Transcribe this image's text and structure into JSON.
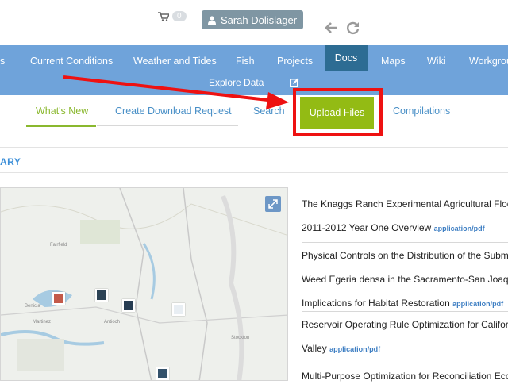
{
  "topbar": {
    "cart_count": "0",
    "user_name": "Sarah Dolislager"
  },
  "nav": {
    "items": [
      "s",
      "Current Conditions",
      "Weather and Tides",
      "Fish",
      "Projects",
      "Docs",
      "Maps",
      "Wiki",
      "Workgrou"
    ],
    "active": "Docs",
    "sub_label": "Explore Data"
  },
  "subtabs": {
    "items": [
      "What's New",
      "Create Download Request",
      "Search",
      "Upload Files",
      "Compilations"
    ],
    "active": "What's New",
    "highlighted": "Upload Files"
  },
  "section": {
    "title": "ARY"
  },
  "documents": [
    {
      "lines": [
        "The Knaggs Ranch Experimental Agricultural Floo",
        "2011-2012 Year One Overview"
      ],
      "type": "application/pdf"
    },
    {
      "lines": [
        "Physical Controls on the Distribution of the Subme",
        "Weed Egeria densa in the Sacramento-San Joaqui",
        "Implications for Habitat Restoration"
      ],
      "type": "application/pdf"
    },
    {
      "lines": [
        "Reservoir Operating Rule Optimization for Califor",
        "Valley"
      ],
      "type": "application/pdf"
    },
    {
      "lines": [
        "Multi-Purpose Optimization for Reconciliation Eco"
      ],
      "type": ""
    }
  ],
  "colors": {
    "navbar": "#6fa3da",
    "nav_active": "#2d6c93",
    "upload_btn": "#93bb14",
    "annotation_red": "#ee1111",
    "link_blue": "#4a90c7",
    "whatsnew_green": "#8ab82e"
  },
  "icons": [
    "cart-icon",
    "user-icon",
    "back-arrow-icon",
    "refresh-icon",
    "edit-icon",
    "expand-icon"
  ]
}
